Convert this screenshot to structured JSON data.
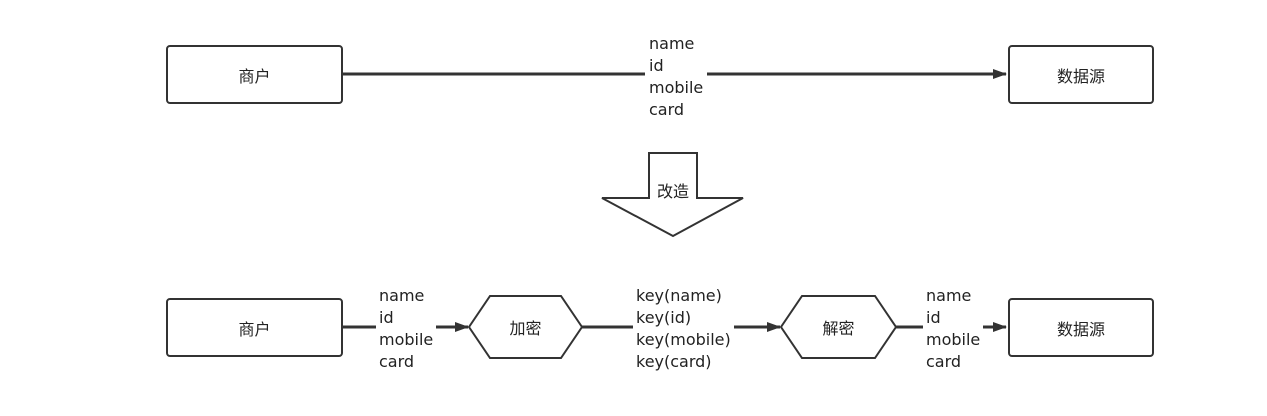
{
  "top_flow": {
    "source": "商户",
    "target": "数据源",
    "fields": [
      "name",
      "id",
      "mobile",
      "card"
    ]
  },
  "transform_arrow": {
    "label": "改造"
  },
  "bottom_flow": {
    "source": "商户",
    "fields_in": [
      "name",
      "id",
      "mobile",
      "card"
    ],
    "encrypt": "加密",
    "fields_encrypted": [
      "key(name)",
      "key(id)",
      "key(mobile)",
      "key(card)"
    ],
    "decrypt": "解密",
    "fields_out": [
      "name",
      "id",
      "mobile",
      "card"
    ],
    "target": "数据源"
  },
  "colors": {
    "stroke": "#333333",
    "background": "#ffffff"
  }
}
